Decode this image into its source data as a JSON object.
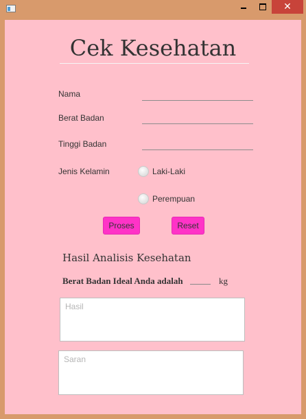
{
  "window": {
    "title": "",
    "controls": {
      "minimize": "",
      "maximize": "",
      "close": "✕"
    }
  },
  "form": {
    "title": "Cek Kesehatan",
    "nama": {
      "label": "Nama",
      "value": ""
    },
    "berat": {
      "label": "Berat Badan",
      "value": ""
    },
    "tinggi": {
      "label": "Tinggi Badan",
      "value": ""
    },
    "gender": {
      "label": "Jenis Kelamin",
      "options": [
        "Laki-Laki",
        "Perempuan"
      ],
      "selected": null
    },
    "buttons": {
      "proses": "Proses",
      "reset": "Reset"
    }
  },
  "hasil": {
    "title": "Hasil Analisis Kesehatan",
    "ideal_text": "Berat Badan Ideal Anda adalah",
    "ideal_value": "",
    "unit": "kg",
    "hasil_placeholder": "Hasil",
    "saran_placeholder": "Saran"
  },
  "colors": {
    "background": "#ffc0cb",
    "frame": "#d89a6c",
    "button": "#ff33c7",
    "close": "#c8433a"
  }
}
